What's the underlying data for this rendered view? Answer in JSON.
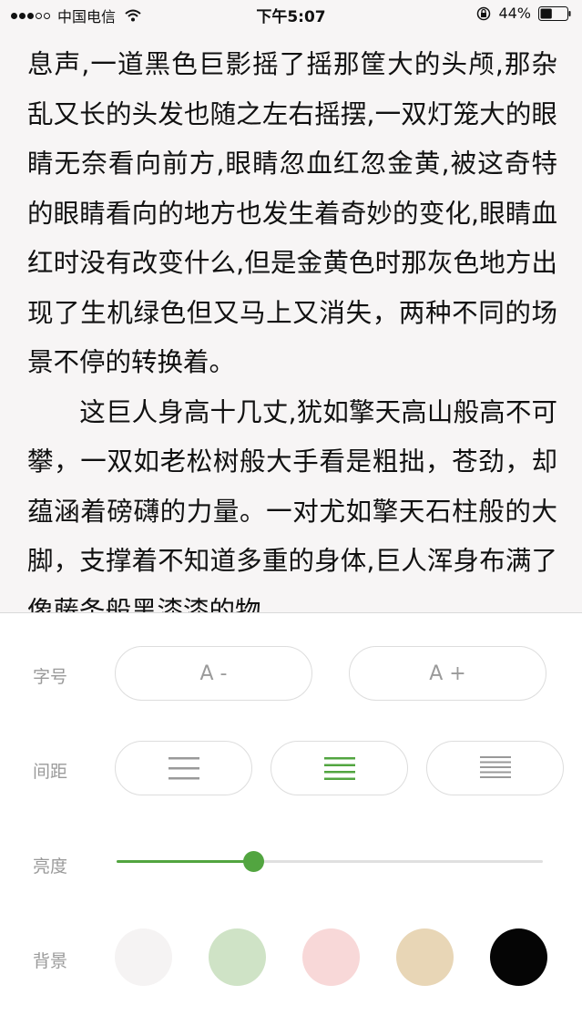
{
  "status_bar": {
    "carrier": "中国电信",
    "time": "下午5:07",
    "battery": "44%",
    "battery_level": 0.44
  },
  "reader": {
    "paragraphs": [
      "息声,一道黑色巨影摇了摇那筐大的头颅,那杂乱又长的头发也随之左右摇摆,一双灯笼大的眼睛无奈看向前方,眼睛忽血红忽金黄,被这奇特的眼睛看向的地方也发生着奇妙的变化,眼睛血红时没有改变什么,但是金黄色时那灰色地方出现了生机绿色但又马上又消失，两种不同的场景不停的转换着。",
      "　　这巨人身高十几丈,犹如擎天高山般高不可攀，一双如老松树般大手看是粗拙，苍劲，却蕴涵着磅礴的力量。一对尤如擎天石柱般的大脚，支撑着不知道多重的身体,巨人浑身布满了像藤条般黑漆漆的物"
    ]
  },
  "settings": {
    "font_size": {
      "label": "字号",
      "decrease": "A -",
      "increase": "A +"
    },
    "spacing": {
      "label": "间距",
      "options": [
        "spacing-wide-icon",
        "spacing-medium-icon",
        "spacing-compact-icon"
      ],
      "selected_index": 1
    },
    "brightness": {
      "label": "亮度",
      "value": 0.32
    },
    "background": {
      "label": "背景",
      "colors": [
        "#f5f3f3",
        "#cfe3c6",
        "#f8d8d8",
        "#e8d6b6",
        "#050505"
      ]
    },
    "accent_color": "#52a540"
  }
}
